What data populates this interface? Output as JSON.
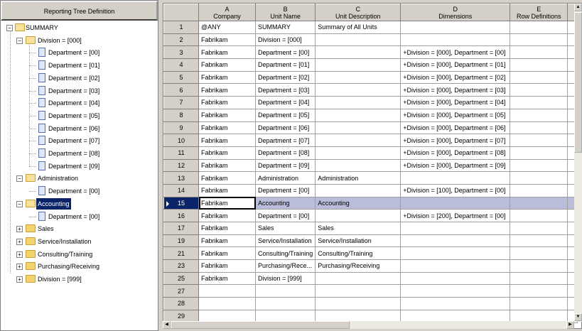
{
  "tree": {
    "header": "Reporting Tree Definition",
    "nodes": [
      {
        "label": "SUMMARY",
        "level": 0,
        "icon": "folder-open",
        "exp": "-"
      },
      {
        "label": "Division = [000]",
        "level": 1,
        "icon": "folder-open",
        "exp": "-"
      },
      {
        "label": "Department = [00]",
        "level": 2,
        "icon": "document"
      },
      {
        "label": "Department = [01]",
        "level": 2,
        "icon": "document"
      },
      {
        "label": "Department = [02]",
        "level": 2,
        "icon": "document"
      },
      {
        "label": "Department = [03]",
        "level": 2,
        "icon": "document"
      },
      {
        "label": "Department = [04]",
        "level": 2,
        "icon": "document"
      },
      {
        "label": "Department = [05]",
        "level": 2,
        "icon": "document"
      },
      {
        "label": "Department = [06]",
        "level": 2,
        "icon": "document"
      },
      {
        "label": "Department = [07]",
        "level": 2,
        "icon": "document"
      },
      {
        "label": "Department = [08]",
        "level": 2,
        "icon": "document"
      },
      {
        "label": "Department = [09]",
        "level": 2,
        "icon": "document"
      },
      {
        "label": "Administration",
        "level": 1,
        "icon": "folder-open",
        "exp": "-"
      },
      {
        "label": "Department = [00]",
        "level": 2,
        "icon": "document"
      },
      {
        "label": "Accounting",
        "level": 1,
        "icon": "folder-open",
        "exp": "-",
        "selected": true
      },
      {
        "label": "Department = [00]",
        "level": 2,
        "icon": "document"
      },
      {
        "label": "Sales",
        "level": 1,
        "icon": "folder",
        "exp": "+"
      },
      {
        "label": "Service/Installation",
        "level": 1,
        "icon": "folder",
        "exp": "+"
      },
      {
        "label": "Consulting/Training",
        "level": 1,
        "icon": "folder",
        "exp": "+"
      },
      {
        "label": "Purchasing/Receiving",
        "level": 1,
        "icon": "folder",
        "exp": "+"
      },
      {
        "label": "Division = [999]",
        "level": 1,
        "icon": "folder",
        "exp": "+"
      }
    ]
  },
  "grid": {
    "columns": [
      {
        "letter": "A",
        "name": "Company"
      },
      {
        "letter": "B",
        "name": "Unit Name"
      },
      {
        "letter": "C",
        "name": "Unit Description"
      },
      {
        "letter": "D",
        "name": "Dimensions"
      },
      {
        "letter": "E",
        "name": "Row Definitions"
      }
    ],
    "rows": [
      {
        "n": "1",
        "cells": [
          "@ANY",
          "SUMMARY",
          "Summary of All Units",
          "",
          ""
        ]
      },
      {
        "n": "2",
        "cells": [
          "Fabrikam",
          "Division = [000]",
          "",
          "",
          ""
        ]
      },
      {
        "n": "3",
        "cells": [
          "Fabrikam",
          "Department = [00]",
          "",
          "+Division = [000], Department = [00]",
          ""
        ]
      },
      {
        "n": "4",
        "cells": [
          "Fabrikam",
          "Department = [01]",
          "",
          "+Division = [000], Department = [01]",
          ""
        ]
      },
      {
        "n": "5",
        "cells": [
          "Fabrikam",
          "Department = [02]",
          "",
          "+Division = [000], Department = [02]",
          ""
        ]
      },
      {
        "n": "6",
        "cells": [
          "Fabrikam",
          "Department = [03]",
          "",
          "+Division = [000], Department = [03]",
          ""
        ]
      },
      {
        "n": "7",
        "cells": [
          "Fabrikam",
          "Department = [04]",
          "",
          "+Division = [000], Department = [04]",
          ""
        ]
      },
      {
        "n": "8",
        "cells": [
          "Fabrikam",
          "Department = [05]",
          "",
          "+Division = [000], Department = [05]",
          ""
        ]
      },
      {
        "n": "9",
        "cells": [
          "Fabrikam",
          "Department = [06]",
          "",
          "+Division = [000], Department = [06]",
          ""
        ]
      },
      {
        "n": "10",
        "cells": [
          "Fabrikam",
          "Department = [07]",
          "",
          "+Division = [000], Department = [07]",
          ""
        ]
      },
      {
        "n": "11",
        "cells": [
          "Fabrikam",
          "Department = [08]",
          "",
          "+Division = [000], Department = [08]",
          ""
        ]
      },
      {
        "n": "12",
        "cells": [
          "Fabrikam",
          "Department = [09]",
          "",
          "+Division = [000], Department = [09]",
          ""
        ]
      },
      {
        "n": "13",
        "cells": [
          "Fabrikam",
          "Administration",
          "Administration",
          "",
          ""
        ]
      },
      {
        "n": "14",
        "cells": [
          "Fabrikam",
          "Department = [00]",
          "",
          "+Division = [100], Department = [00]",
          ""
        ]
      },
      {
        "n": "15",
        "cells": [
          "Fabrikam",
          "Accounting",
          "Accounting",
          "",
          ""
        ],
        "selected": true
      },
      {
        "n": "16",
        "cells": [
          "Fabrikam",
          "Department = [00]",
          "",
          "+Division = [200], Department = [00]",
          ""
        ]
      },
      {
        "n": "17",
        "cells": [
          "Fabrikam",
          "Sales",
          "Sales",
          "",
          ""
        ]
      },
      {
        "n": "19",
        "cells": [
          "Fabrikam",
          "Service/Installation",
          "Service/Installation",
          "",
          ""
        ]
      },
      {
        "n": "21",
        "cells": [
          "Fabrikam",
          "Consulting/Training",
          "Consulting/Training",
          "",
          ""
        ]
      },
      {
        "n": "23",
        "cells": [
          "Fabrikam",
          "Purchasing/Rece...",
          "Purchasing/Receiving",
          "",
          ""
        ]
      },
      {
        "n": "25",
        "cells": [
          "Fabrikam",
          "Division = [999]",
          "",
          "",
          ""
        ]
      },
      {
        "n": "27",
        "cells": [
          "",
          "",
          "",
          "",
          ""
        ]
      },
      {
        "n": "28",
        "cells": [
          "",
          "",
          "",
          "",
          ""
        ]
      },
      {
        "n": "29",
        "cells": [
          "",
          "",
          "",
          "",
          ""
        ]
      }
    ]
  }
}
